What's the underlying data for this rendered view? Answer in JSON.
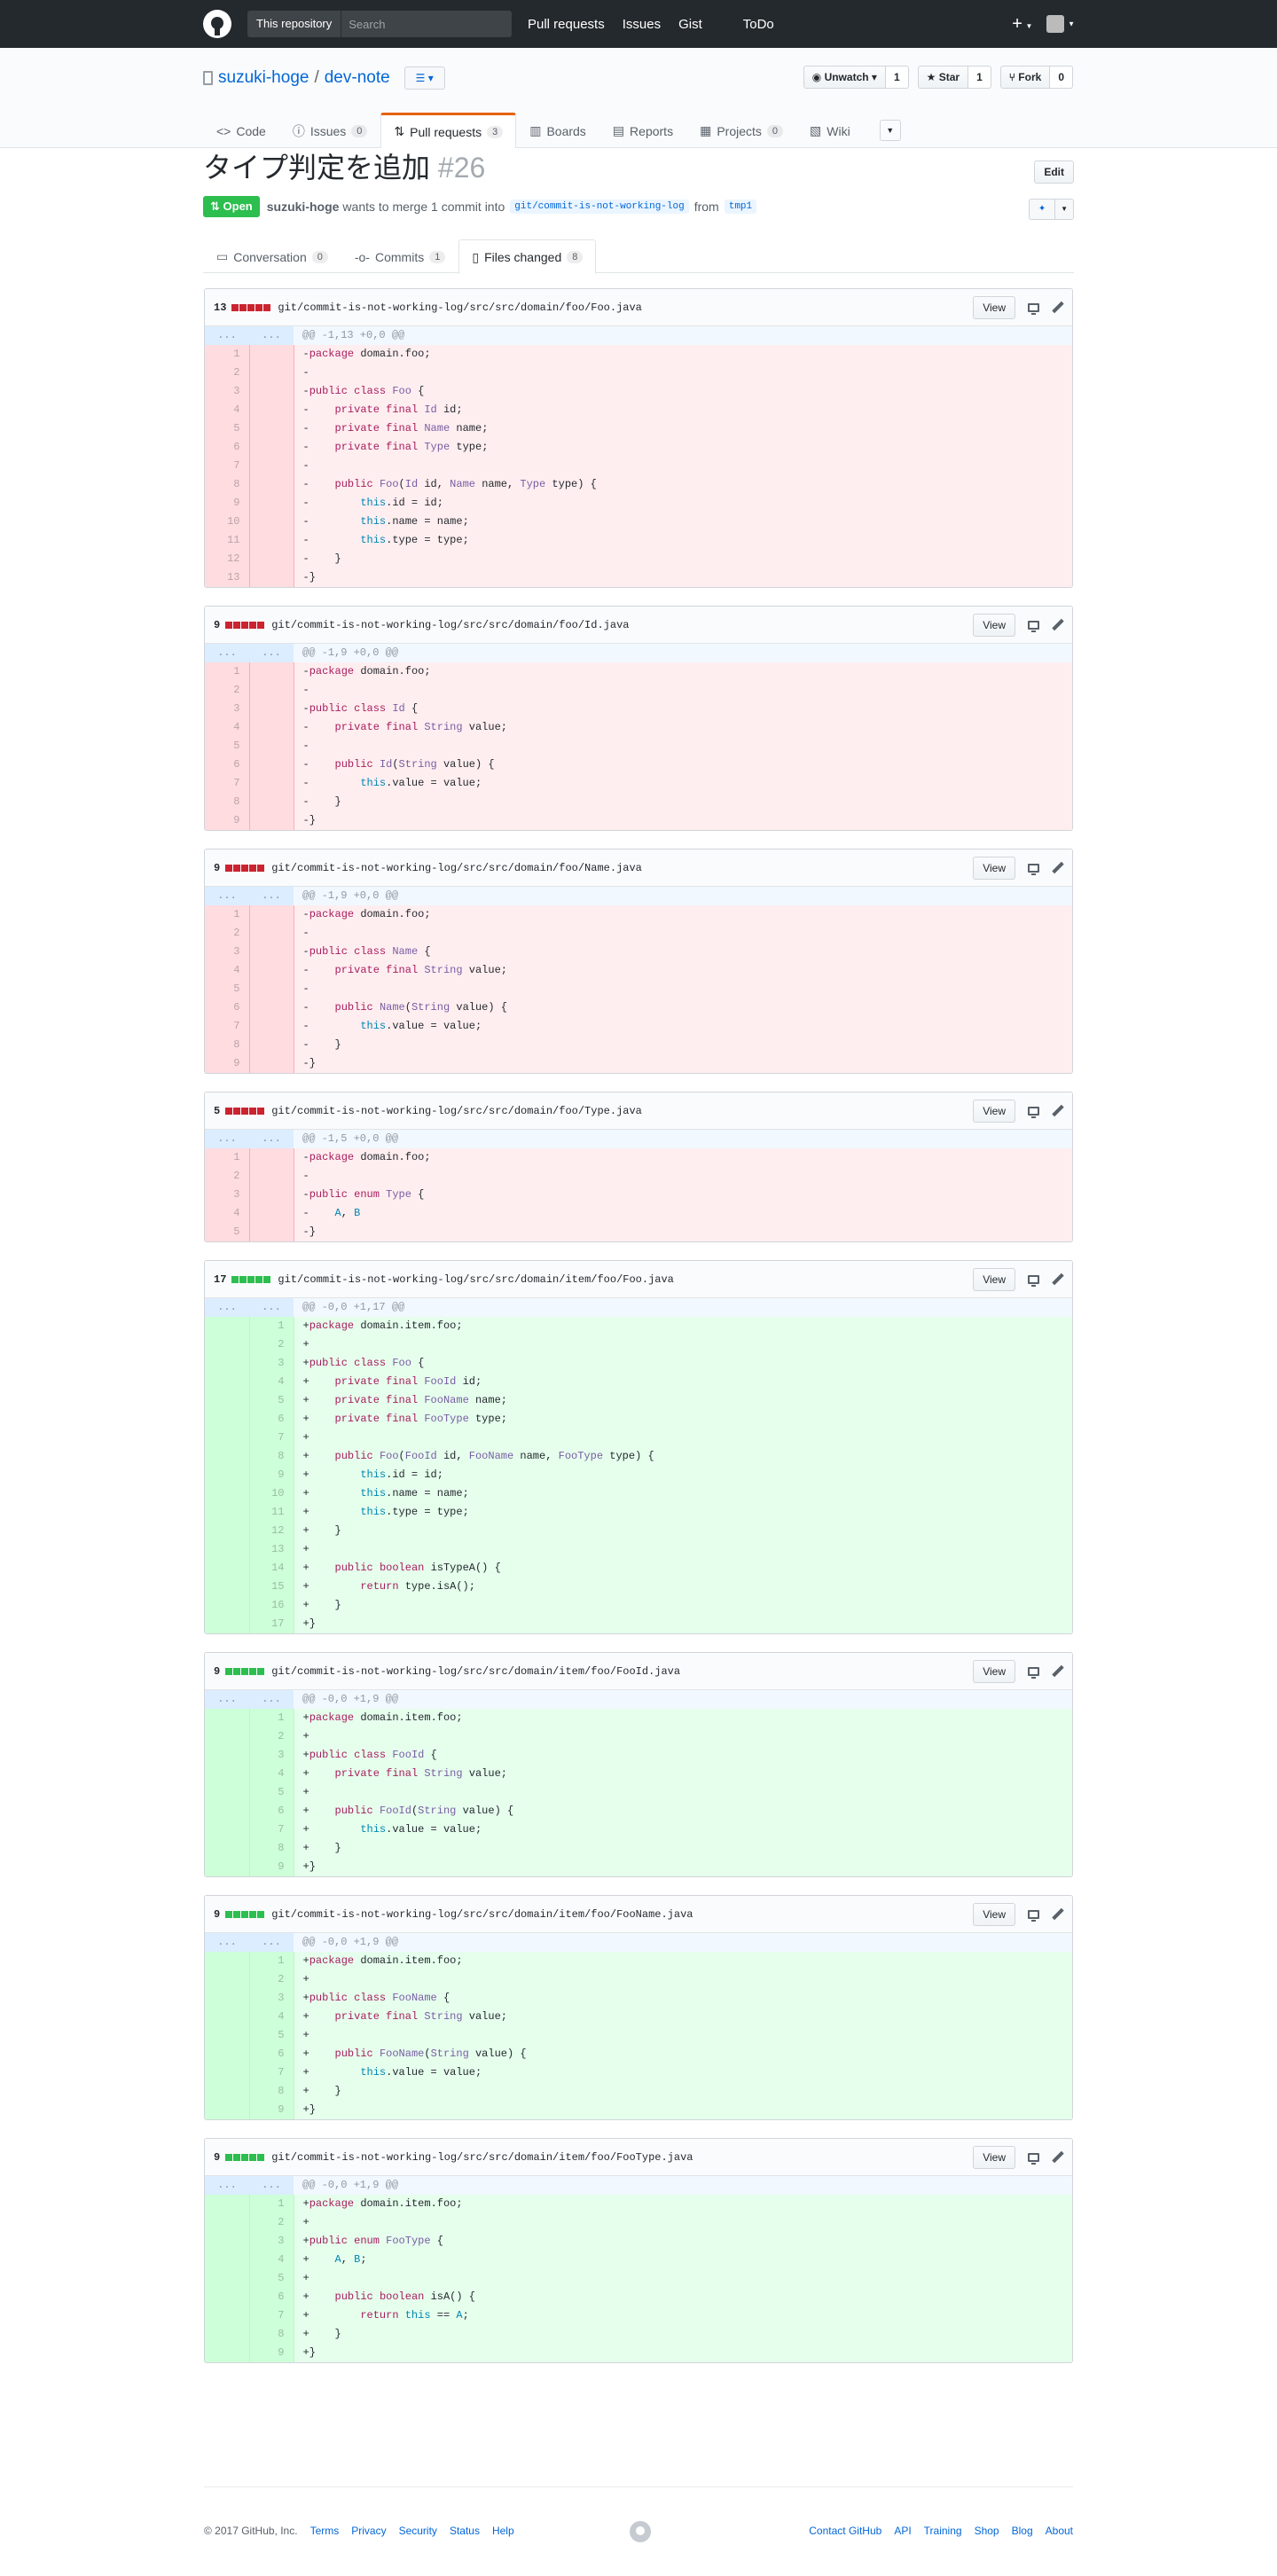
{
  "header": {
    "search_scope": "This repository",
    "search_placeholder": "Search",
    "nav": [
      "Pull requests",
      "Issues",
      "Gist",
      "ToDo"
    ],
    "plus": "+"
  },
  "repo": {
    "owner": "suzuki-hoge",
    "separator": "/",
    "name": "dev-note",
    "actions": {
      "watch_label": "Unwatch",
      "watch_count": "1",
      "star_label": "Star",
      "star_count": "1",
      "fork_label": "Fork",
      "fork_count": "0"
    },
    "tabs": [
      {
        "label": "Code",
        "count": ""
      },
      {
        "label": "Issues",
        "count": "0"
      },
      {
        "label": "Pull requests",
        "count": "3"
      },
      {
        "label": "Boards",
        "count": ""
      },
      {
        "label": "Reports",
        "count": ""
      },
      {
        "label": "Projects",
        "count": "0"
      },
      {
        "label": "Wiki",
        "count": ""
      }
    ]
  },
  "pr": {
    "title": "タイプ判定を追加",
    "number": "#26",
    "edit_label": "Edit",
    "state": "Open",
    "author": "suzuki-hoge",
    "merge_text": "wants to merge 1 commit into",
    "base_branch": "git/commit-is-not-working-log",
    "from_text": "from",
    "head_branch": "tmp1",
    "tabs": [
      {
        "label": "Conversation",
        "count": "0"
      },
      {
        "label": "Commits",
        "count": "1"
      },
      {
        "label": "Files changed",
        "count": "8"
      }
    ]
  },
  "file_header": {
    "view_label": "View",
    "ellipsis": "..."
  },
  "files": [
    {
      "count": "13",
      "kind": "del",
      "path": "git/commit-is-not-working-log/src/src/domain/foo/Foo.java",
      "hunk": "@@ -1,13 +0,0 @@",
      "lines": [
        "-package domain.foo;",
        "-",
        "-public class Foo {",
        "-    private final Id id;",
        "-    private final Name name;",
        "-    private final Type type;",
        "-",
        "-    public Foo(Id id, Name name, Type type) {",
        "-        this.id = id;",
        "-        this.name = name;",
        "-        this.type = type;",
        "-    }",
        "-}"
      ]
    },
    {
      "count": "9",
      "kind": "del",
      "path": "git/commit-is-not-working-log/src/src/domain/foo/Id.java",
      "hunk": "@@ -1,9 +0,0 @@",
      "lines": [
        "-package domain.foo;",
        "-",
        "-public class Id {",
        "-    private final String value;",
        "-",
        "-    public Id(String value) {",
        "-        this.value = value;",
        "-    }",
        "-}"
      ]
    },
    {
      "count": "9",
      "kind": "del",
      "path": "git/commit-is-not-working-log/src/src/domain/foo/Name.java",
      "hunk": "@@ -1,9 +0,0 @@",
      "lines": [
        "-package domain.foo;",
        "-",
        "-public class Name {",
        "-    private final String value;",
        "-",
        "-    public Name(String value) {",
        "-        this.value = value;",
        "-    }",
        "-}"
      ]
    },
    {
      "count": "5",
      "kind": "del",
      "path": "git/commit-is-not-working-log/src/src/domain/foo/Type.java",
      "hunk": "@@ -1,5 +0,0 @@",
      "lines": [
        "-package domain.foo;",
        "-",
        "-public enum Type {",
        "-    A, B",
        "-}"
      ]
    },
    {
      "count": "17",
      "kind": "add",
      "path": "git/commit-is-not-working-log/src/src/domain/item/foo/Foo.java",
      "hunk": "@@ -0,0 +1,17 @@",
      "lines": [
        "+package domain.item.foo;",
        "+",
        "+public class Foo {",
        "+    private final FooId id;",
        "+    private final FooName name;",
        "+    private final FooType type;",
        "+",
        "+    public Foo(FooId id, FooName name, FooType type) {",
        "+        this.id = id;",
        "+        this.name = name;",
        "+        this.type = type;",
        "+    }",
        "+",
        "+    public boolean isTypeA() {",
        "+        return type.isA();",
        "+    }",
        "+}"
      ]
    },
    {
      "count": "9",
      "kind": "add",
      "path": "git/commit-is-not-working-log/src/src/domain/item/foo/FooId.java",
      "hunk": "@@ -0,0 +1,9 @@",
      "lines": [
        "+package domain.item.foo;",
        "+",
        "+public class FooId {",
        "+    private final String value;",
        "+",
        "+    public FooId(String value) {",
        "+        this.value = value;",
        "+    }",
        "+}"
      ]
    },
    {
      "count": "9",
      "kind": "add",
      "path": "git/commit-is-not-working-log/src/src/domain/item/foo/FooName.java",
      "hunk": "@@ -0,0 +1,9 @@",
      "lines": [
        "+package domain.item.foo;",
        "+",
        "+public class FooName {",
        "+    private final String value;",
        "+",
        "+    public FooName(String value) {",
        "+        this.value = value;",
        "+    }",
        "+}"
      ]
    },
    {
      "count": "9",
      "kind": "add",
      "path": "git/commit-is-not-working-log/src/src/domain/item/foo/FooType.java",
      "hunk": "@@ -0,0 +1,9 @@",
      "lines": [
        "+package domain.item.foo;",
        "+",
        "+public enum FooType {",
        "+    A, B;",
        "+",
        "+    public boolean isA() {",
        "+        return this == A;",
        "+    }",
        "+}"
      ]
    }
  ],
  "footer": {
    "copyright": "© 2017 GitHub, Inc.",
    "left_links": [
      "Terms",
      "Privacy",
      "Security",
      "Status",
      "Help"
    ],
    "right_links": [
      "Contact GitHub",
      "API",
      "Training",
      "Shop",
      "Blog",
      "About"
    ]
  },
  "colors": {
    "header_bg": "#24292e",
    "open_green": "#2cbe4e",
    "deletion_bg": "#ffeef0",
    "addition_bg": "#e6ffed",
    "link_blue": "#0366d6",
    "tab_accent": "#e36209"
  }
}
